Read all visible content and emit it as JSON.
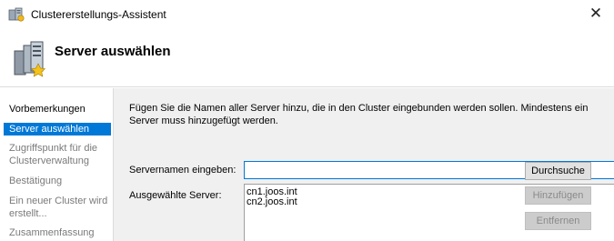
{
  "window": {
    "title": "Clustererstellungs-Assistent",
    "close_glyph": "✕"
  },
  "header": {
    "title": "Server auswählen"
  },
  "nav": {
    "items": [
      {
        "label": "Vorbemerkungen",
        "state": "done"
      },
      {
        "label": "Server auswählen",
        "state": "active"
      },
      {
        "label": "Zugriffspunkt für die Clusterverwaltung",
        "state": "pending"
      },
      {
        "label": "Bestätigung",
        "state": "pending"
      },
      {
        "label": "Ein neuer Cluster wird erstellt...",
        "state": "pending"
      },
      {
        "label": "Zusammenfassung",
        "state": "pending"
      }
    ]
  },
  "main": {
    "intro": "Fügen Sie die Namen aller Server hinzu, die in den Cluster eingebunden werden sollen. Mindestens ein Server muss hinzugefügt werden.",
    "server_name_label": "Servernamen eingeben:",
    "server_name_value": "",
    "browse_button": "Durchsuche",
    "selected_label": "Ausgewählte Server:",
    "selected_servers": [
      "cn1.joos.int",
      "cn2.joos.int"
    ],
    "add_button": "Hinzufügen",
    "remove_button": "Entfernen"
  },
  "colors": {
    "accent": "#0078d7",
    "content_bg": "#f0f0f0",
    "disabled_text": "#8a8a8a"
  }
}
